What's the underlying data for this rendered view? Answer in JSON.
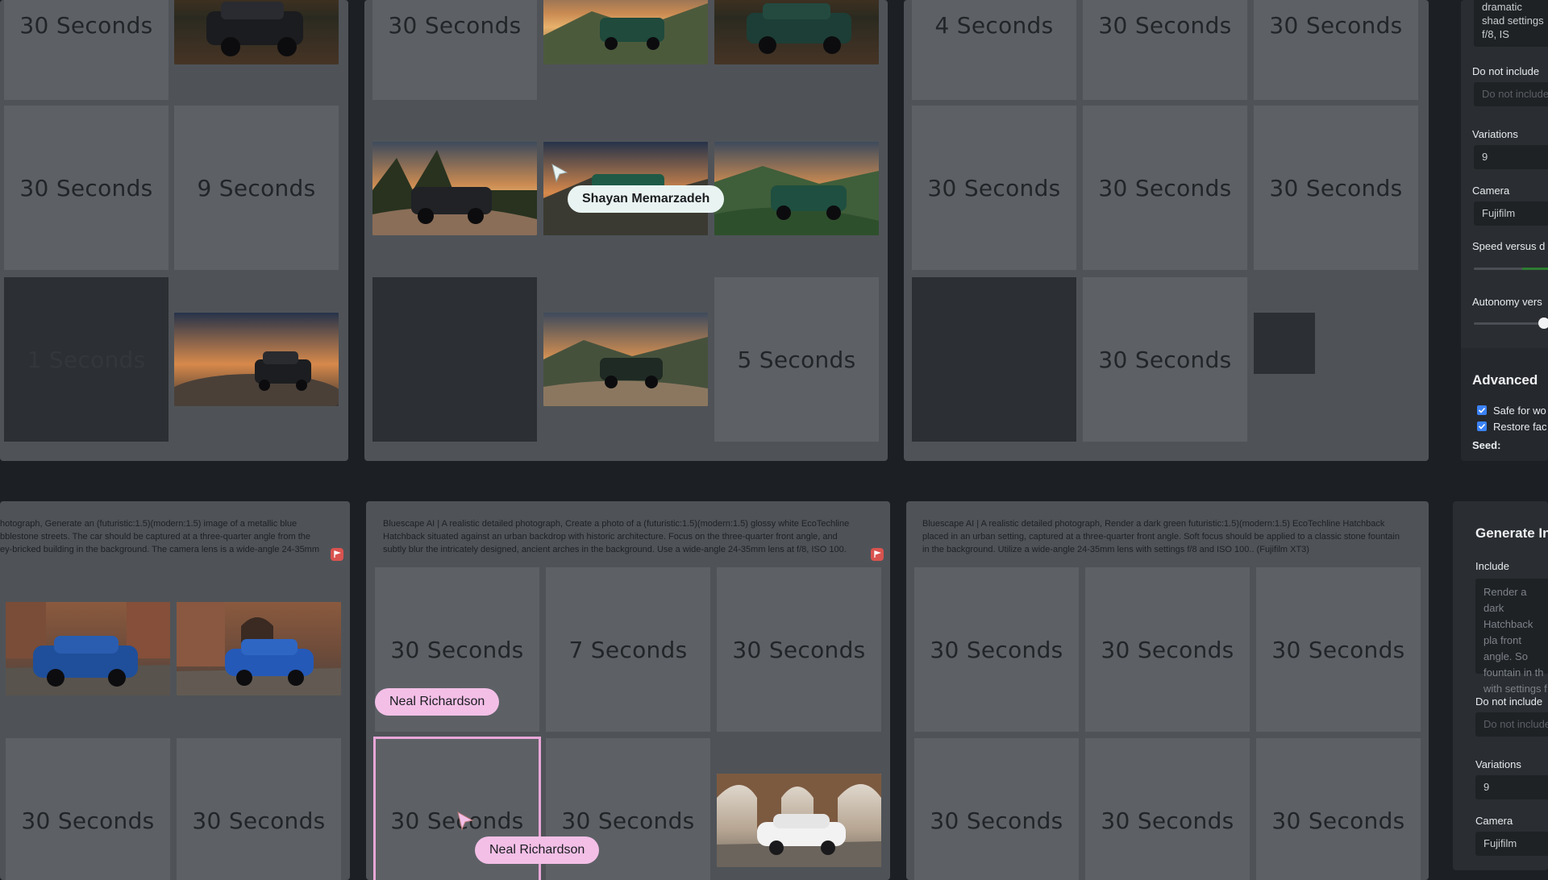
{
  "panels": {
    "p1": {
      "tiles": [
        "30 Seconds",
        "30 Seconds",
        "9 Seconds",
        "1 Seconds"
      ]
    },
    "p2": {
      "tiles": [
        "30 Seconds",
        "5 Seconds"
      ]
    },
    "p3": {
      "tiles": [
        "4 Seconds",
        "30 Seconds",
        "30 Seconds",
        "30 Seconds",
        "30 Seconds",
        "30 Seconds",
        "30 Seconds"
      ]
    },
    "p4": {
      "prompt": "hotograph, Generate an (futuristic:1.5)(modern:1.5) image of a metallic blue bblestone streets. The car should be captured at a three-quarter angle from the ey-bricked building in the background. The camera lens is a wide-angle 24-35mm",
      "tiles": [
        "30 Seconds",
        "30 Seconds"
      ]
    },
    "p5": {
      "prompt": "Bluescape AI | A realistic detailed photograph, Create a photo of a (futuristic:1.5)(modern:1.5) glossy white EcoTechline Hatchback situated against an urban backdrop with historic architecture. Focus on the three-quarter front angle, and subtly blur the intricately designed, ancient arches in the background. Use a wide-angle 24-35mm lens at f/8, ISO 100.",
      "tiles": [
        "30 Seconds",
        "7 Seconds",
        "30 Seconds",
        "30 Seconds",
        "30 Seconds"
      ]
    },
    "p6": {
      "prompt": "Bluescape AI | A realistic detailed photograph, Render a dark green futuristic:1.5)(modern:1.5) EcoTechline Hatchback placed in an urban setting, captured at a three-quarter front angle. Soft focus should be applied to a classic stone fountain in the background. Utilize a wide-angle 24-35mm lens with settings f/8 and ISO 100.. (Fujifilm XT3)",
      "tiles": [
        "30 Seconds",
        "30 Seconds",
        "30 Seconds",
        "30 Seconds",
        "30 Seconds",
        "30 Seconds"
      ]
    }
  },
  "collaborators": {
    "shayan": "Shayan Memarzadeh",
    "neal_1": "Neal Richardson",
    "neal_2": "Neal Richardson"
  },
  "sidebar_top": {
    "include_text": "dramatic shad settings f/8, IS",
    "exclude_label": "Do not include",
    "exclude_placeholder": "Do not include",
    "variations_label": "Variations",
    "variations_value": "9",
    "camera_label": "Camera",
    "camera_value": "Fujifilm",
    "speed_label": "Speed versus d",
    "autonomy_label": "Autonomy vers",
    "advanced_heading": "Advanced",
    "safe_label": "Safe for wo",
    "restore_label": "Restore fac",
    "seed_label": "Seed:"
  },
  "sidebar_bottom": {
    "heading": "Generate In",
    "include_label": "Include",
    "include_text": "Render a dark Hatchback pla front angle. So fountain in th with settings f",
    "exclude_label": "Do not include",
    "exclude_placeholder": "Do not include",
    "variations_label": "Variations",
    "variations_value": "9",
    "camera_label": "Camera",
    "camera_value": "Fujifilm"
  },
  "colors": {
    "background": "#1c1f23",
    "panel": "#4f5358",
    "tile": "#5d6166",
    "highlight_pink": "#e8a7d8",
    "tag_white": "#e9f4f2",
    "tag_pink": "#f3bfe7",
    "checkbox_blue": "#3b82f6",
    "flag_red": "#d9534f"
  }
}
